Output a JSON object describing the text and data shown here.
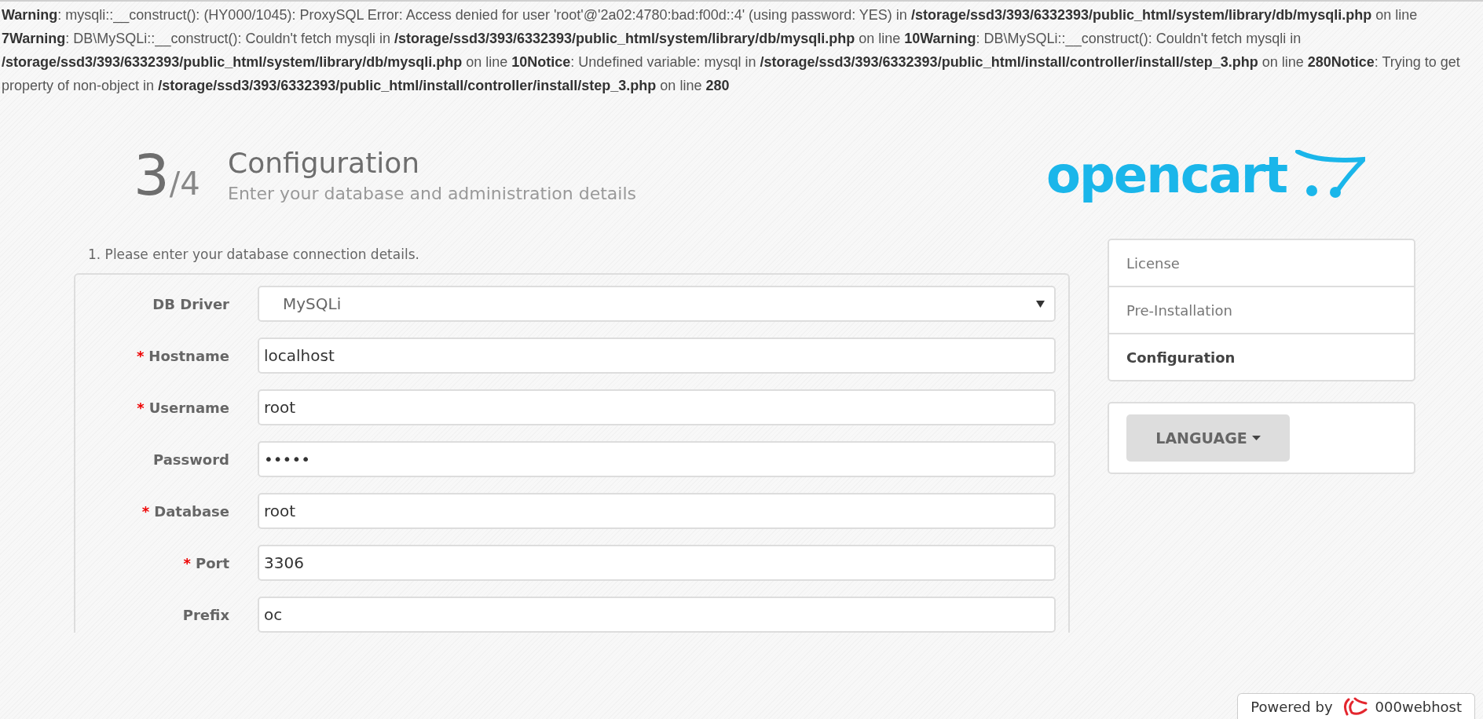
{
  "error_log": "**Warning**: mysqli::__construct(): (HY000/1045): ProxySQL Error: Access denied for user 'root'@'2a02:4780:bad:f00d::4' (using password: YES) in **/storage/ssd3/393/6332393/public_html/system/library/db/mysqli.php** on line **7Warning**: DB\\MySQLi::__construct(): Couldn't fetch mysqli in **/storage/ssd3/393/6332393/public_html/system/library/db/mysqli.php** on line **10Warning**: DB\\MySQLi::__construct(): Couldn't fetch mysqli in **/storage/ssd3/393/6332393/public_html/system/library/db/mysqli.php** on line **10Notice**: Undefined variable: mysql in **/storage/ssd3/393/6332393/public_html/install/controller/install/step_3.php** on line **280Notice**: Trying to get property of non-object in **/storage/ssd3/393/6332393/public_html/install/controller/install/step_3.php** on line **280**",
  "header": {
    "step": "3",
    "total": "/4",
    "title": "Configuration",
    "subtitle": "Enter your database and administration details",
    "logo": "opencart"
  },
  "form": {
    "section_title": "1. Please enter your database connection details.",
    "fields": [
      {
        "kind": "select",
        "label": "DB Driver",
        "value": "MySQLi"
      },
      {
        "kind": "text",
        "marker": "*",
        "label": "Hostname",
        "value": "localhost"
      },
      {
        "kind": "text",
        "marker": "*",
        "label": "Username",
        "value": "root"
      },
      {
        "kind": "text",
        "label": "Password",
        "value": "•••••"
      },
      {
        "kind": "text",
        "marker": "*",
        "label": "Database",
        "value": "root"
      },
      {
        "kind": "text",
        "marker": "*",
        "label": "Port",
        "value": "3306"
      },
      {
        "kind": "text",
        "label": "Prefix",
        "value": "oc"
      }
    ]
  },
  "steps": [
    {
      "label": "License",
      "selected": false
    },
    {
      "label": "Pre-Installation",
      "selected": false
    },
    {
      "label": "Configuration",
      "selected": true
    }
  ],
  "language_button": "LANGUAGE",
  "badge": {
    "prefix": "Powered by",
    "brand": "000webhost"
  }
}
